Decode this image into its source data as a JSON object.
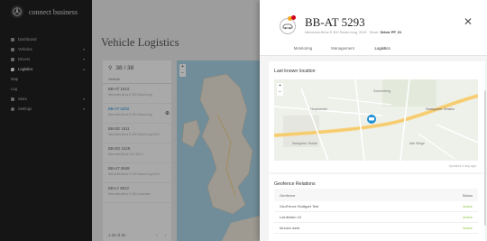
{
  "sidebar": {
    "brand": "connect business",
    "items": [
      {
        "label": "Dashboard",
        "icon": "dashboard-icon"
      },
      {
        "label": "Vehicles",
        "icon": "car-icon"
      },
      {
        "label": "Drivers",
        "icon": "person-icon"
      },
      {
        "label": "Logistics",
        "icon": "location-icon"
      },
      {
        "label": "Map",
        "sub": true
      },
      {
        "label": "Log",
        "sub": true
      },
      {
        "label": "Store",
        "icon": "cart-icon"
      },
      {
        "label": "Settings",
        "icon": "gear-icon"
      }
    ]
  },
  "main": {
    "title": "Vehicle Logistics",
    "list": {
      "count": "38 / 38",
      "column": "Vehicle",
      "vehicles": [
        {
          "plate": "BB-AT 1613",
          "desc": "Mercedes-Benz E 300 Sedan long"
        },
        {
          "plate": "BB-AT 5293",
          "desc": "Mercedes-Benz E 300 Sedan long",
          "selected": true
        },
        {
          "plate": "BB-DE 1611",
          "desc": "Mercedes-Benz E 200 Sedan long 2019"
        },
        {
          "plate": "BB-DD 2429",
          "desc": "Mercedes-Benz GLC 250 4"
        },
        {
          "plate": "BB-UT 9948",
          "desc": "Mercedes-Benz E 300 Sedan long 2019"
        },
        {
          "plate": "BB-LY 8913",
          "desc": "Mercedes-Benz E 200 Limousine"
        }
      ],
      "footer": "1-25 of 38"
    }
  },
  "detail": {
    "plate": "BB-AT 5293",
    "model": "Mercedes-Benz E 300 Sedan long, 2019",
    "driver_label": "Driver:",
    "driver": "Driver PP_01",
    "close": "✕",
    "tabs": [
      "Monitoring",
      "Management",
      "Logistics"
    ],
    "active_tab": "Logistics",
    "location": {
      "title": "Last known location",
      "updated": "Updated a day ago",
      "streets": [
        "Stuttgarter Straße",
        "Hauptstraße",
        "Stuttgarter Straße",
        "Alte Steige",
        "Sonnenberg"
      ]
    },
    "geofence": {
      "title": "Geofence Relations",
      "col_name": "Geofence",
      "col_status": "Status",
      "rows": [
        {
          "name": "GeoFence Stuttgart Test",
          "status": "Active"
        },
        {
          "name": "Leinfelden 10",
          "status": "Active"
        },
        {
          "name": "Munich west",
          "status": "Active"
        }
      ]
    }
  },
  "colors": {
    "accent": "#1e90d6",
    "active_status": "#8cc63e",
    "sidebar_bg": "#1f1f1f"
  }
}
